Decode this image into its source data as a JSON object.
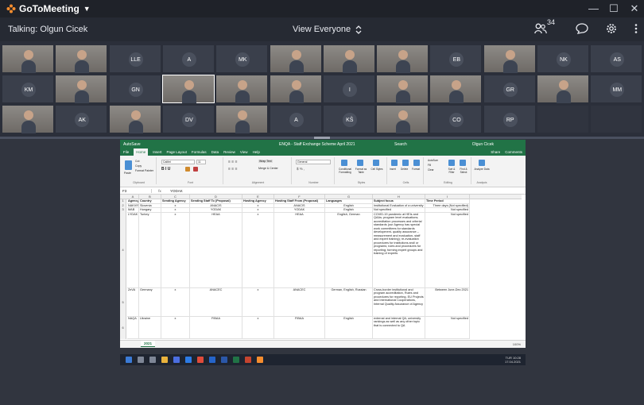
{
  "app": {
    "name": "GoToMeeting",
    "talking": "Talking: Olgun Cicek",
    "view": "View Everyone",
    "attendee_count": "34"
  },
  "participants": {
    "row1": [
      "",
      "",
      "LLE",
      "A",
      "MK",
      "",
      "",
      "",
      "EB",
      "",
      "NK",
      "AS"
    ],
    "row2": [
      "KM",
      "",
      "GN",
      "",
      "",
      "",
      "I",
      "",
      "",
      "GR",
      "",
      "MM"
    ],
    "row3": [
      "",
      "AK",
      "",
      "DV",
      "",
      "A",
      "KŠ",
      "",
      "CO",
      "RP",
      "",
      ""
    ]
  },
  "excel": {
    "title_left": "AutoSave",
    "file_name": "ENQA - Staff Exchange Scheme April 2021",
    "search": "Search",
    "user": "Olgun Cicek",
    "tabs": [
      "File",
      "Home",
      "Insert",
      "Page Layout",
      "Formulas",
      "Data",
      "Review",
      "View",
      "Help"
    ],
    "share": "Share",
    "comments": "Comments",
    "ribbon_groups": [
      "Clipboard",
      "Font",
      "Alignment",
      "Number",
      "Styles",
      "Cells",
      "Editing",
      "Analysis"
    ],
    "ribbon_items": {
      "cut": "Cut",
      "copy": "Copy",
      "format_painter": "Format Painter",
      "paste": "Paste",
      "font_name": "Calibri",
      "font_size": "11",
      "wrap_text": "Wrap Text",
      "merge_center": "Merge & Center",
      "number_format": "General",
      "conditional_formatting": "Conditional Formatting",
      "format_as_table": "Format as Table",
      "cell_styles": "Cell Styles",
      "insert": "Insert",
      "delete": "Delete",
      "format": "Format",
      "autosum": "AutoSum",
      "fill": "Fill",
      "clear": "Clear",
      "sort_filter": "Sort & Filter",
      "find_select": "Find & Select",
      "analyze_data": "Analyze Data"
    },
    "name_box": "F3",
    "formula_value": "YODAK",
    "columns": [
      "A",
      "B",
      "C",
      "D",
      "E",
      "F",
      "G",
      "H",
      "I"
    ],
    "headers": [
      "Agency",
      "Country",
      "Sending Agency",
      "Sending Staff To (Proposal)",
      "Hosting Agency",
      "Hosting Staff From (Proposal)",
      "Languages",
      "Subject focus",
      "Time Period"
    ],
    "rows": [
      {
        "num": "2",
        "cells": [
          "NAKVIS",
          "Slovenia",
          "x",
          "ANACIS",
          "x",
          "ANACIS",
          "English",
          "Institutional Evaluation of a university",
          "Three days  (Not specified)"
        ]
      },
      {
        "num": "3",
        "cells": [
          "MAB",
          "Hungary",
          "x",
          "YODAK",
          "x",
          "YODAK",
          "English",
          "Not specified",
          "Not specified"
        ]
      },
      {
        "num": "4",
        "cells": [
          "LYDAK",
          "Turkey",
          "x",
          "HEAA",
          "x",
          "HEAA",
          "English, German",
          "COVID-19 pandemic at HEIs and QAAs; program level evaluations; accreditation processes and criteria/ standards (our Agency has special work committees for standards development- quality assurance – measurement and evaluation- staff and expert training); re-evaluation procedures for institutions and/ or programs; rules and procedures for reporting; forming expert groups and training of experts",
          "Not specified"
        ]
      },
      {
        "num": "5",
        "cells": [
          "ZeVA",
          "Germany",
          "x",
          "ANACEC",
          "x",
          "ANACEC",
          "German, English, Russian",
          "Cross-border institutional and program accreditation, Rules and procedures for reporting, EU Projects and International Cooperations, Internal Quality Assurance of Agency",
          "Between June-Dec 2021"
        ]
      },
      {
        "num": "6",
        "cells": [
          "NAQA",
          "Ukraine",
          "x",
          "FIBAA",
          "x",
          "FIBAA",
          "English",
          "external and internal QA; university rankings as well as any other topic that is connected to QA",
          "Not specified"
        ]
      }
    ],
    "sheet_tab": "2021",
    "zoom": "100%"
  },
  "taskbar": {
    "time": "10:28",
    "date": "17.04.2021",
    "lang": "TUR"
  }
}
